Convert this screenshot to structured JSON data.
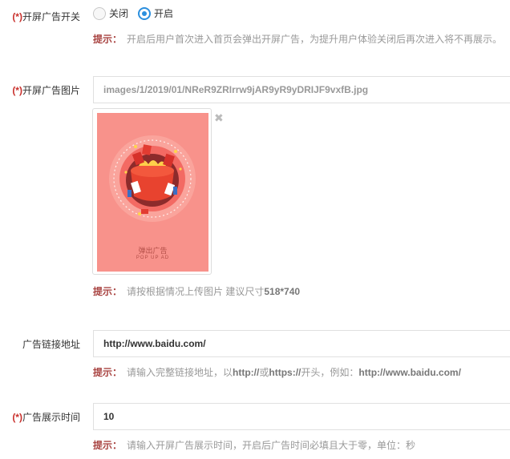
{
  "required_mark": "(*)",
  "splash_switch": {
    "label": "开屏广告开关",
    "options": [
      {
        "label": "关闭",
        "checked": false
      },
      {
        "label": "开启",
        "checked": true
      }
    ],
    "tip_key": "提示：",
    "tip": "开启后用户首次进入首页会弹出开屏广告，为提升用户体验关闭后再次进入将不再展示。"
  },
  "splash_image": {
    "label": "开屏广告图片",
    "path": "images/1/2019/01/NReR9ZRIrrw9jAR9yR9yDRIJF9vxfB.jpg",
    "poster_title": "弹出广告",
    "poster_subtitle": "POP UP AD",
    "remove_icon": "close-icon",
    "tip_key": "提示：",
    "tip_prefix": "请按根据情况上传图片 建议尺寸",
    "tip_size": "518*740"
  },
  "ad_link": {
    "label": "广告链接地址",
    "value": "http://www.baidu.com/",
    "tip_key": "提示：",
    "tip_parts": [
      "请输入完整链接地址，以",
      "http://",
      "或",
      "https://",
      "开头，例如：",
      "http://www.baidu.com/"
    ]
  },
  "ad_duration": {
    "label": "广告展示时间",
    "value": "10",
    "tip_key": "提示：",
    "tip": "请输入开屏广告展示时间，开启后广告时间必填且大于零，单位：秒"
  },
  "colors": {
    "accent": "#2b8fde",
    "required": "#c9302c",
    "tip_key": "#a94442",
    "poster_bg": "#f8928b"
  }
}
